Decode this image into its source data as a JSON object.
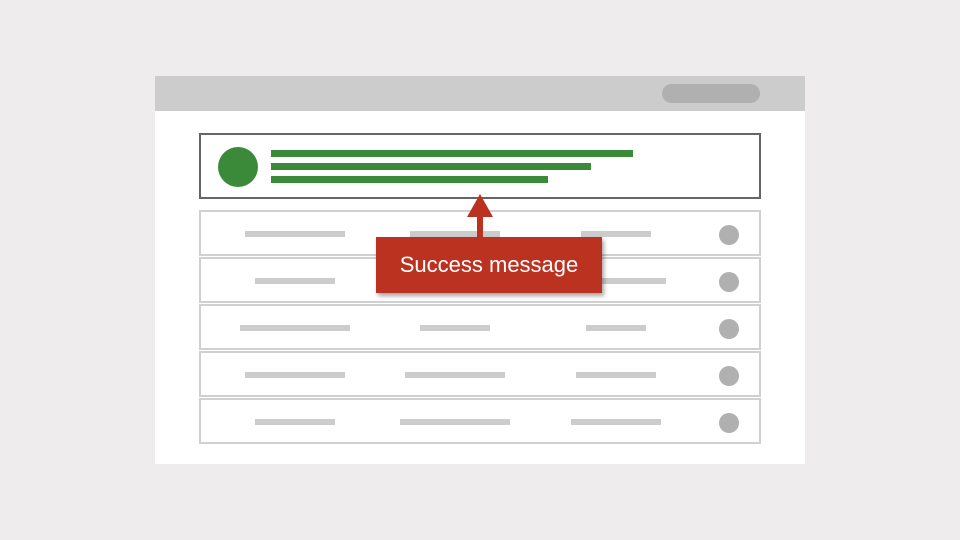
{
  "callout": {
    "label": "Success message",
    "color": "#bb3320"
  },
  "colors": {
    "background": "#eeeced",
    "window": "#ffffff",
    "titlebar": "#cccccc",
    "success": "#3a8a3a",
    "placeholder": "#cccccc",
    "row_dot": "#b0b0b0"
  },
  "table": {
    "row_count": 5,
    "columns_per_row": 3
  }
}
